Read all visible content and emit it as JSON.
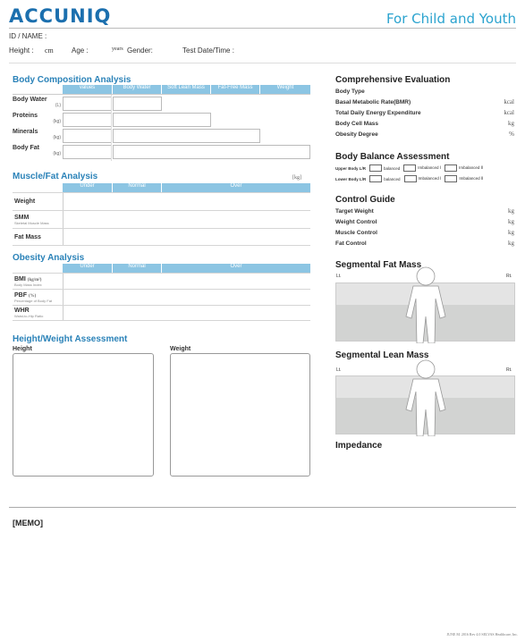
{
  "header": {
    "logo": "ACCUNIQ",
    "tagline": "For Child and Youth",
    "id_label": "ID / NAME :",
    "height_label": "Height :",
    "height_unit": "cm",
    "age_label": "Age :",
    "age_unit": "years",
    "gender_label": "Gender:",
    "date_label": "Test Date/Time :"
  },
  "body_composition": {
    "title": "Body Composition Analysis",
    "columns": [
      "values",
      "Body Water",
      "Soft Lean Mass",
      "Fat-Free Mass",
      "Weight"
    ],
    "rows": [
      {
        "label": "Body Water",
        "unit": "(L)"
      },
      {
        "label": "Proteins",
        "unit": "(kg)"
      },
      {
        "label": "Minerals",
        "unit": "(kg)"
      },
      {
        "label": "Body Fat",
        "unit": "(kg)"
      }
    ]
  },
  "muscle_fat": {
    "title": "Muscle/Fat Analysis",
    "unit": "[kg]",
    "scale": [
      "Under",
      "Normal",
      "Over"
    ],
    "rows": [
      {
        "label": "Weight",
        "sub": ""
      },
      {
        "label": "SMM",
        "sub": "Skeletal Muscle Mass"
      },
      {
        "label": "Fat Mass",
        "sub": ""
      }
    ]
  },
  "obesity": {
    "title": "Obesity Analysis",
    "scale": [
      "Under",
      "Normal",
      "Over"
    ],
    "rows": [
      {
        "label": "BMI",
        "unit": "(kg/m²)",
        "sub": "Body Mass Index"
      },
      {
        "label": "PBF",
        "unit": "(%)",
        "sub": "Percentage of Body Fat"
      },
      {
        "label": "WHR",
        "unit": "",
        "sub": "Waist-to-Hip Ratio"
      }
    ]
  },
  "hw_assessment": {
    "title": "Height/Weight Assessment",
    "height_label": "Height",
    "weight_label": "Weight"
  },
  "comprehensive": {
    "title": "Comprehensive Evaluation",
    "rows": [
      {
        "label": "Body Type",
        "unit": ""
      },
      {
        "label": "Basal Metabolic Rate(BMR)",
        "unit": "kcal"
      },
      {
        "label": "Total Daily Energy Expenditure",
        "unit": "kcal"
      },
      {
        "label": "Body Cell Mass",
        "unit": "kg"
      },
      {
        "label": "Obesity Degree",
        "unit": "%"
      }
    ]
  },
  "balance": {
    "title": "Body Balance Assessment",
    "upper": "Upper Body L/R",
    "lower": "Lower Body L/R",
    "balanced": "balanced",
    "imbalanced1": "Imbalanced Ⅰ",
    "imbalanced2": "Imbalanced Ⅱ"
  },
  "control": {
    "title": "Control Guide",
    "rows": [
      {
        "label": "Target Weight",
        "unit": "kg"
      },
      {
        "label": "Weight Control",
        "unit": "kg"
      },
      {
        "label": "Muscle Control",
        "unit": "kg"
      },
      {
        "label": "Fat Control",
        "unit": "kg"
      }
    ]
  },
  "seg_fat": {
    "title": "Segmental Fat Mass",
    "left": "Lt.",
    "right": "Rt."
  },
  "seg_lean": {
    "title": "Segmental Lean Mass",
    "left": "Lt.",
    "right": "Rt."
  },
  "impedance": {
    "title": "Impedance"
  },
  "memo": {
    "title": "[MEMO]"
  },
  "footer": {
    "text": "JUNE M. 2016 Rev 4.0 SELVAS Healthcare, Inc."
  },
  "colors": {
    "brand": "#1b6fae",
    "accent": "#2ba3cf",
    "table_header": "#8cc5e3"
  }
}
